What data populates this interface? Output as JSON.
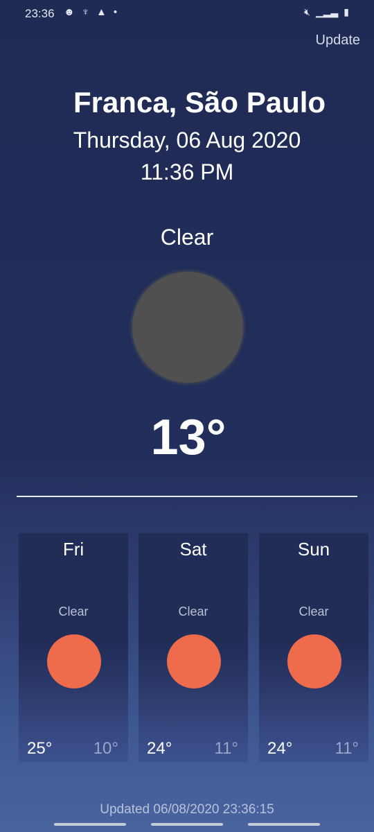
{
  "status_bar": {
    "time": "23:36",
    "icons": [
      "face-icon",
      "usb-icon",
      "warning-icon",
      "dot-icon"
    ],
    "right_icons": [
      "mute-vibrate-icon",
      "signal-icon",
      "battery-charging-icon"
    ]
  },
  "header": {
    "update_label": "Update"
  },
  "location": {
    "city": "Franca, São Paulo",
    "date": "Thursday, 06 Aug 2020",
    "time": "11:36 PM"
  },
  "current": {
    "condition": "Clear",
    "temperature": "13°",
    "icon": "moon-icon"
  },
  "forecast": [
    {
      "day": "Fri",
      "condition": "Clear",
      "high": "25°",
      "low": "10°",
      "icon": "sun-icon"
    },
    {
      "day": "Sat",
      "condition": "Clear",
      "high": "24°",
      "low": "11°",
      "icon": "sun-icon"
    },
    {
      "day": "Sun",
      "condition": "Clear",
      "high": "24°",
      "low": "11°",
      "icon": "sun-icon"
    }
  ],
  "footer": {
    "updated_text": "Updated 06/08/2020 23:36:15"
  },
  "colors": {
    "sun": "#ee6b4c",
    "moon": "#505050",
    "background": "#222f5c"
  }
}
